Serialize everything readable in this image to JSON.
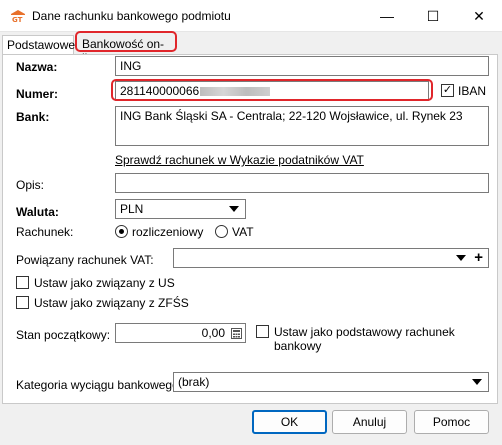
{
  "window": {
    "title": "Dane rachunku bankowego podmiotu",
    "minimize_glyph": "—",
    "maximize_glyph": "☐",
    "close_glyph": "✕"
  },
  "tabs": [
    {
      "label": "Podstawowe",
      "active": true
    },
    {
      "label": "Bankowość on-line",
      "active": false
    }
  ],
  "form": {
    "nazwa_label": "Nazwa:",
    "nazwa_value": "ING",
    "numer_label": "Numer:",
    "numer_value": "281140000066",
    "iban_label": "IBAN",
    "iban_checked": "✓",
    "bank_label": "Bank:",
    "bank_value": "ING Bank Śląski SA - Centrala; 22-120 Wojsławice, ul. Rynek 23",
    "verify_link": "Sprawdź rachunek w Wykazie podatników VAT",
    "opis_label": "Opis:",
    "opis_value": "",
    "waluta_label": "Waluta:",
    "waluta_value": "PLN",
    "rachunek_label": "Rachunek:",
    "rachunek_option1": "rozliczeniowy",
    "rachunek_option2": "VAT",
    "powiazany_label": "Powiązany rachunek VAT:",
    "powiazany_value": "",
    "plus_glyph": "+",
    "us_label": "Ustaw jako związany z US",
    "zfss_label": "Ustaw jako związany z ZFŚS",
    "stan_label": "Stan początkowy:",
    "stan_value": "0,00",
    "podstawowy_label": "Ustaw jako podstawowy rachunek bankowy",
    "kategoria_label": "Kategoria wyciągu bankowego:",
    "kategoria_value": "(brak)"
  },
  "buttons": {
    "ok": "OK",
    "cancel": "Anuluj",
    "help": "Pomoc"
  },
  "colors": {
    "highlight": "#e0262b",
    "default_button_border": "#0067c0"
  }
}
